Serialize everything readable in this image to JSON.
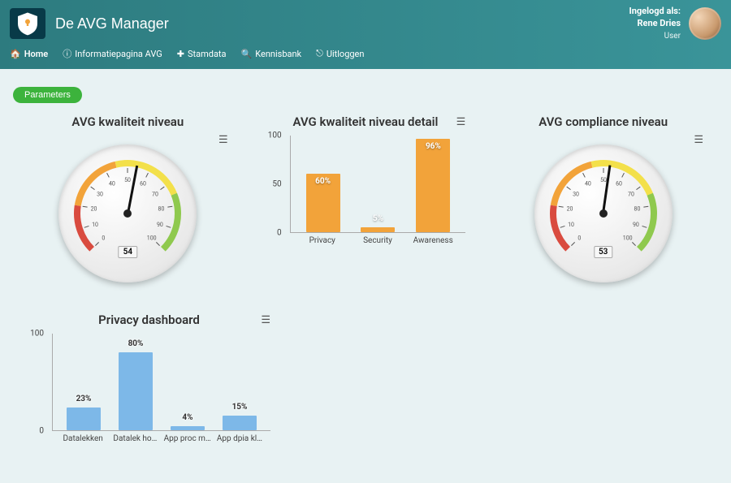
{
  "header": {
    "app_title": "De AVG Manager",
    "user": {
      "logged_in_label": "Ingelogd als:",
      "name": "Rene Dries",
      "role": "User"
    },
    "nav": {
      "home": "Home",
      "info": "Informatiepagina AVG",
      "stamdata": "Stamdata",
      "kennis": "Kennisbank",
      "uitloggen": "Uitloggen"
    }
  },
  "buttons": {
    "parameters": "Parameters"
  },
  "cards": {
    "gauge1_title": "AVG kwaliteit niveau",
    "gauge2_title": "AVG compliance niveau",
    "detail_title": "AVG kwaliteit niveau detail",
    "privacy_title": "Privacy dashboard"
  },
  "gauges": {
    "kwaliteit": {
      "value": 54
    },
    "compliance": {
      "value": 53
    }
  },
  "chart_data": [
    {
      "id": "detail",
      "type": "bar",
      "title": "AVG kwaliteit niveau detail",
      "ylim": [
        0,
        100
      ],
      "yticks": [
        0,
        50,
        100
      ],
      "series_color": "#f2a33a",
      "categories": [
        "Privacy",
        "Security",
        "Awareness"
      ],
      "values": [
        60,
        5,
        96
      ],
      "value_labels": [
        "60%",
        "5%",
        "96%"
      ]
    },
    {
      "id": "privacy",
      "type": "bar",
      "title": "Privacy dashboard",
      "ylim": [
        0,
        100
      ],
      "yticks": [
        0,
        100
      ],
      "series_color": "#7db8e8",
      "categories": [
        "Datalekken",
        "Datalek ho…",
        "App proc m…",
        "App dpia kl…"
      ],
      "values": [
        23,
        80,
        4,
        15
      ],
      "value_labels": [
        "23%",
        "80%",
        "4%",
        "15%"
      ]
    }
  ]
}
